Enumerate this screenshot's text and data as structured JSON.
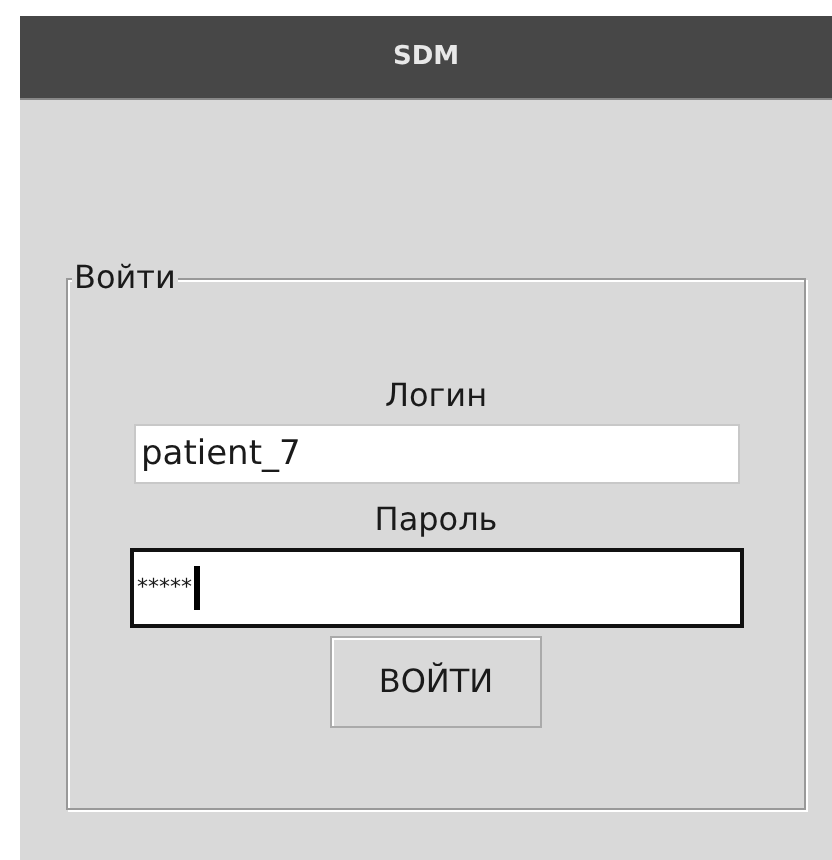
{
  "window": {
    "title": "SDM"
  },
  "group": {
    "title": "Войти"
  },
  "fields": [
    {
      "label": "Логин",
      "value": "patient_7",
      "focused": false
    },
    {
      "label": "Пароль",
      "value": "*****",
      "focused": true
    }
  ],
  "button": {
    "label": "ВОЙТИ"
  }
}
